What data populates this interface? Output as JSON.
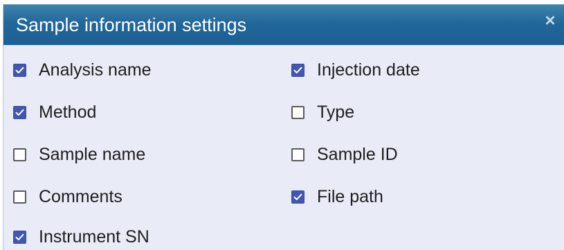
{
  "dialog": {
    "title": "Sample information settings",
    "close_glyph": "×",
    "close_icon": "close-icon"
  },
  "options": [
    {
      "label": "Analysis name",
      "checked": true
    },
    {
      "label": "Injection date",
      "checked": true
    },
    {
      "label": "Method",
      "checked": true
    },
    {
      "label": "Type",
      "checked": false
    },
    {
      "label": "Sample name",
      "checked": false
    },
    {
      "label": "Sample ID",
      "checked": false
    },
    {
      "label": "Comments",
      "checked": false
    },
    {
      "label": "File path",
      "checked": true
    },
    {
      "label": "Instrument SN",
      "checked": true
    }
  ],
  "colors": {
    "title_bar": "#21679a",
    "panel_background": "#e9ebf7",
    "checkbox_checked": "#4356b0"
  }
}
